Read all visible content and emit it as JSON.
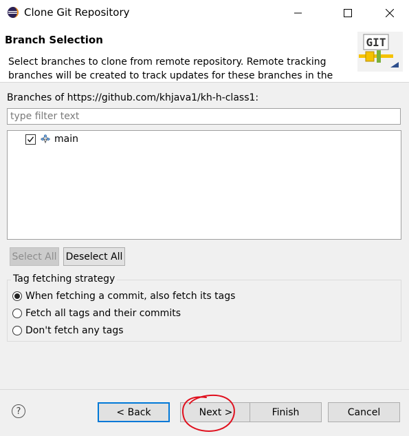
{
  "window": {
    "title": "Clone Git Repository",
    "minimize_icon": "minimize-icon",
    "maximize_icon": "maximize-icon",
    "close_icon": "close-icon"
  },
  "header": {
    "title": "Branch Selection",
    "description": "Select branches to clone from remote repository. Remote tracking branches will be created to track updates for these branches in the",
    "logo_text": "GIT"
  },
  "branches": {
    "label": "Branches of https://github.com/khjava1/kh-h-class1:",
    "filter_placeholder": "type filter text",
    "items": [
      {
        "name": "main",
        "checked": true
      }
    ]
  },
  "buttons": {
    "select_all": "Select All",
    "deselect_all": "Deselect All",
    "back": "< Back",
    "next": "Next >",
    "finish": "Finish",
    "cancel": "Cancel"
  },
  "tag_strategy": {
    "title": "Tag fetching strategy",
    "options": [
      {
        "label": "When fetching a commit, also fetch its tags",
        "selected": true
      },
      {
        "label": "Fetch all tags and their commits",
        "selected": false
      },
      {
        "label": "Don't fetch any tags",
        "selected": false
      }
    ]
  },
  "help_icon": "help-icon",
  "annotation_color": "#e0101e"
}
